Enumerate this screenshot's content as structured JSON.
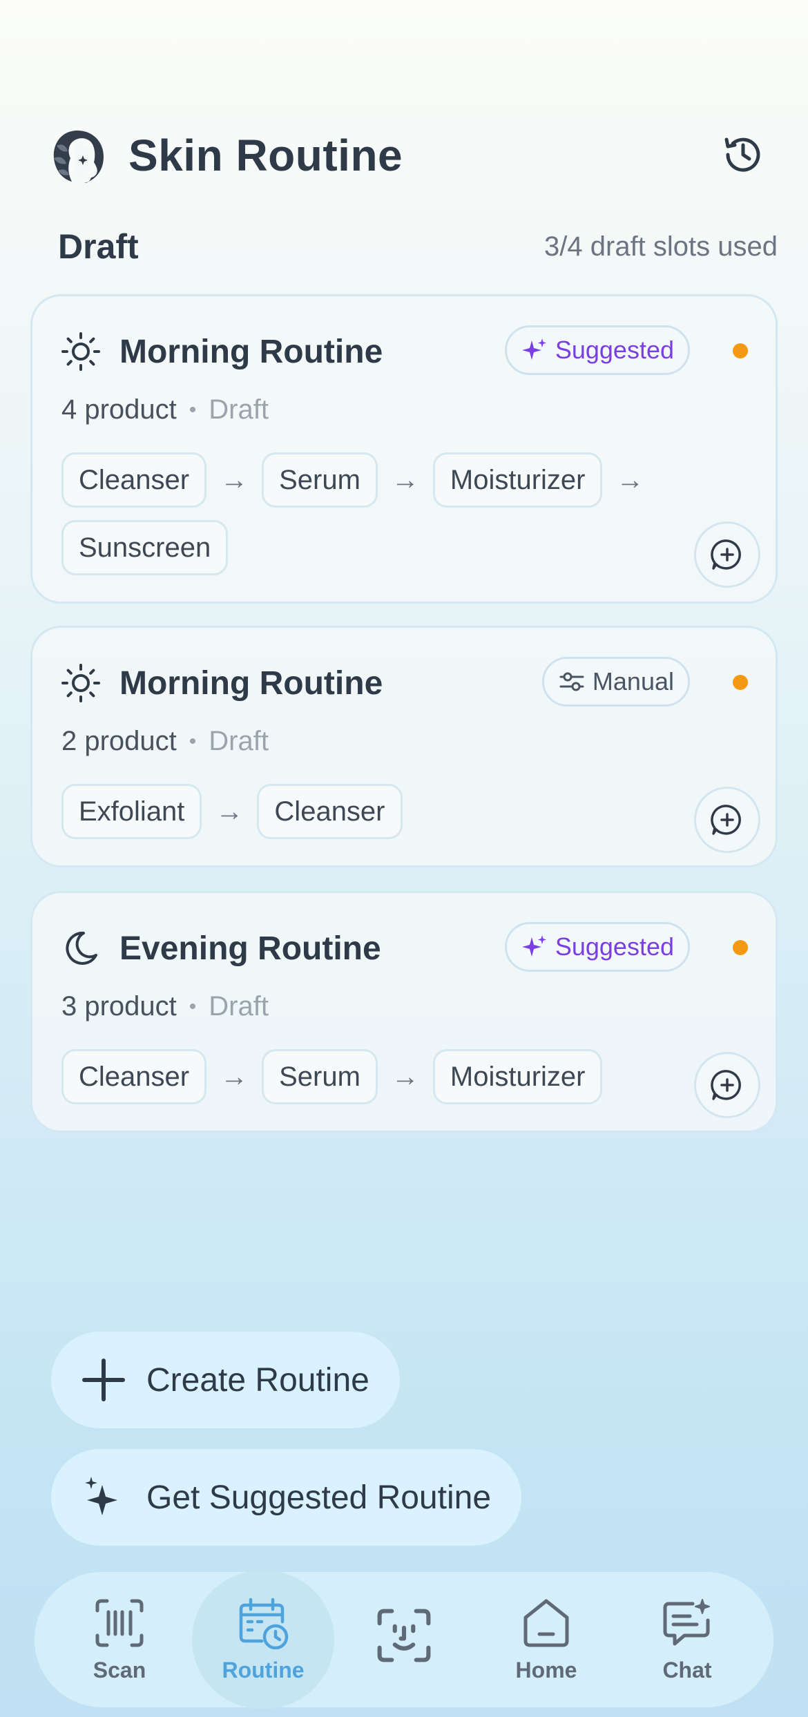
{
  "header": {
    "title": "Skin Routine"
  },
  "section": {
    "title": "Draft",
    "slots": "3/4 draft slots used"
  },
  "routines": [
    {
      "title": "Morning Routine",
      "icon": "sun-icon",
      "badge": "Suggested",
      "badge_type": "suggested",
      "count": "4 product",
      "status": "Draft",
      "steps": [
        "Cleanser",
        "Serum",
        "Moisturizer",
        "Sunscreen"
      ]
    },
    {
      "title": "Morning Routine",
      "icon": "sun-icon",
      "badge": "Manual",
      "badge_type": "manual",
      "count": "2 product",
      "status": "Draft",
      "steps": [
        "Exfoliant",
        "Cleanser"
      ]
    },
    {
      "title": "Evening Routine",
      "icon": "moon-icon",
      "badge": "Suggested",
      "badge_type": "suggested",
      "count": "3 product",
      "status": "Draft",
      "steps": [
        "Cleanser",
        "Serum",
        "Moisturizer"
      ]
    }
  ],
  "separators": {
    "meta": "•",
    "arrow": "→"
  },
  "actions": {
    "create": "Create Routine",
    "suggest": "Get Suggested Routine"
  },
  "nav": [
    {
      "label": "Scan",
      "icon": "barcode-icon"
    },
    {
      "label": "Routine",
      "icon": "calendar-clock-icon",
      "active": true
    },
    {
      "label": "",
      "icon": "face-scan-icon"
    },
    {
      "label": "Home",
      "icon": "home-icon"
    },
    {
      "label": "Chat",
      "icon": "chat-sparkle-icon"
    }
  ],
  "colors": {
    "accent": "#4fa3dc",
    "suggested": "#7a3fe0",
    "status_dot": "#f49a12"
  }
}
